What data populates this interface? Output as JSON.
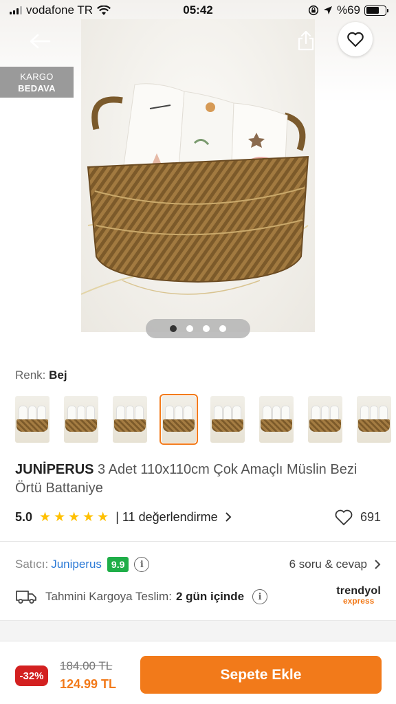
{
  "status_bar": {
    "carrier": "vodafone TR",
    "time": "05:42",
    "battery": "%69",
    "battery_level": 0.69,
    "icons": [
      "signal-icon",
      "wifi-icon",
      "lock-rotation-icon",
      "location-icon",
      "battery-icon"
    ]
  },
  "hero": {
    "badge_line1": "KARGO",
    "badge_line2": "BEDAVA",
    "image_count": 4,
    "active_image": 1,
    "icons": [
      "back-arrow-icon",
      "share-icon",
      "heart-icon"
    ]
  },
  "variant": {
    "label": "Renk:",
    "value": "Bej",
    "thumbnail_count": 8,
    "selected_thumbnail": 4
  },
  "product": {
    "brand": "JUNİPERUS",
    "name": "3 Adet 110x110cm Çok Amaçlı Müslin Bezi Örtü Battaniye"
  },
  "rating": {
    "score": "5.0",
    "stars": 5,
    "reviews_text": "| 11 değerlendirme",
    "favorites": "691"
  },
  "seller": {
    "label": "Satıcı:",
    "name": "Juniperus",
    "score": "9.9",
    "qa_text": "6 soru & cevap"
  },
  "delivery": {
    "label": "Tahmini Kargoya Teslim:",
    "value": "2 gün içinde",
    "carrier_line1": "trendyol",
    "carrier_line2": "express"
  },
  "pricing": {
    "discount": "-32%",
    "old_price": "184.00 TL",
    "new_price": "124.99 TL",
    "button_label": "Sepete Ekle"
  },
  "colors": {
    "accent": "#f27a1a",
    "discount_red": "#d32020",
    "seller_score_green": "#1fae48",
    "link_blue": "#2b7ad6",
    "star_yellow": "#ffc000"
  }
}
